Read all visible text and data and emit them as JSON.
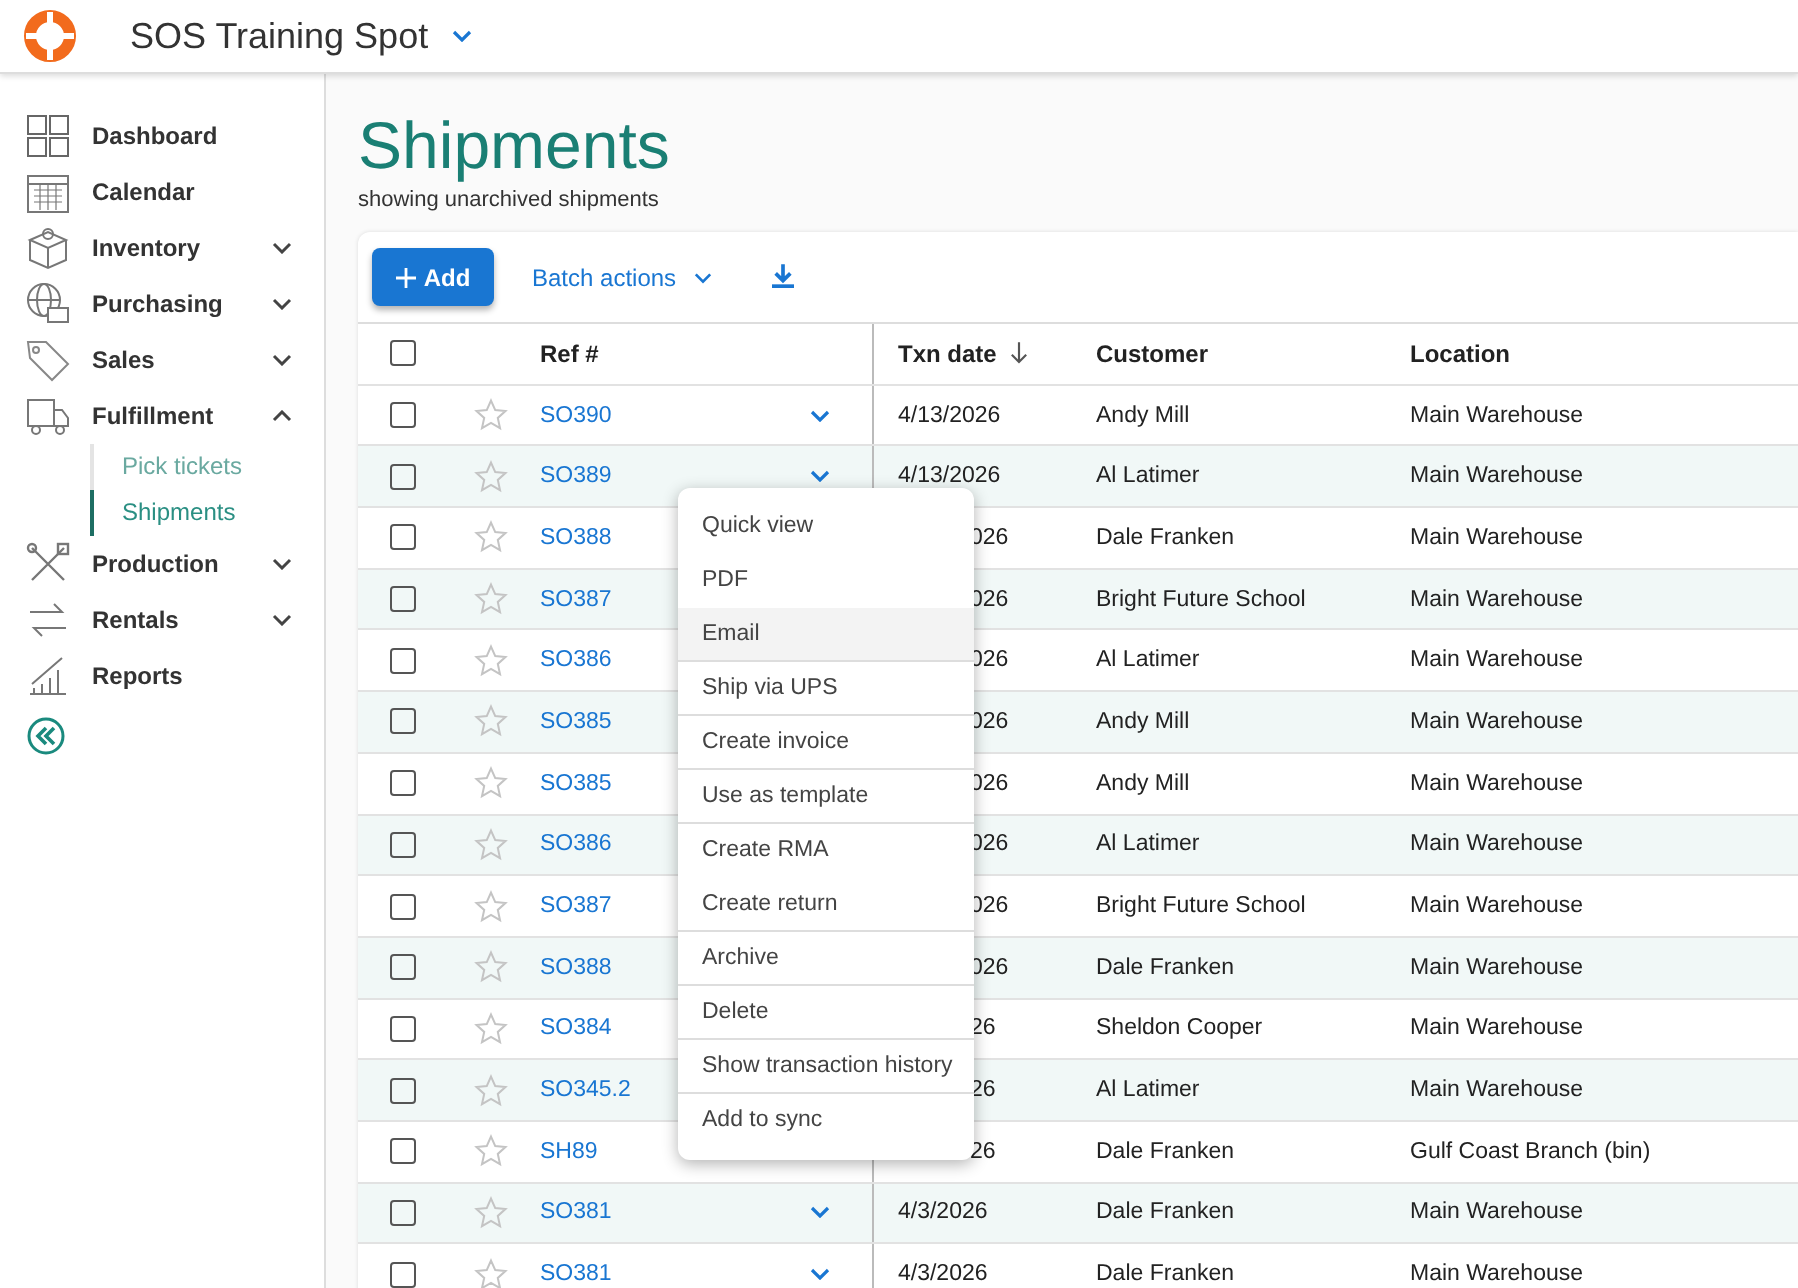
{
  "app": {
    "title": "SOS Training Spot"
  },
  "sidebar": {
    "items": [
      {
        "label": "Dashboard",
        "kind": "link"
      },
      {
        "label": "Calendar",
        "kind": "link"
      },
      {
        "label": "Inventory",
        "kind": "group",
        "expanded": false
      },
      {
        "label": "Purchasing",
        "kind": "group",
        "expanded": false
      },
      {
        "label": "Sales",
        "kind": "group",
        "expanded": false
      },
      {
        "label": "Fulfillment",
        "kind": "group",
        "expanded": true,
        "children": [
          {
            "label": "Pick tickets",
            "selected": false
          },
          {
            "label": "Shipments",
            "selected": true
          }
        ]
      },
      {
        "label": "Production",
        "kind": "group",
        "expanded": false
      },
      {
        "label": "Rentals",
        "kind": "group",
        "expanded": false
      },
      {
        "label": "Reports",
        "kind": "link"
      }
    ]
  },
  "page": {
    "title": "Shipments",
    "subtitle": "showing unarchived shipments"
  },
  "toolbar": {
    "add": "Add",
    "batch": "Batch actions"
  },
  "table": {
    "select_all": false,
    "columns": [
      {
        "label": "Ref #",
        "sorted": false
      },
      {
        "label": "Txn date",
        "sorted": true
      },
      {
        "label": "Customer",
        "sorted": false
      },
      {
        "label": "Location",
        "sorted": false
      }
    ],
    "rows": [
      {
        "ref": "SO390",
        "date": "4/13/2026",
        "date_cut": false,
        "customer": "Andy Mill",
        "location": "Main Warehouse",
        "checked": false,
        "starred": false,
        "caret": true
      },
      {
        "ref": "SO389",
        "date": "4/13/2026",
        "date_cut": false,
        "customer": "Al Latimer",
        "location": "Main Warehouse",
        "checked": false,
        "starred": false,
        "caret": true
      },
      {
        "ref": "SO388",
        "date": "026",
        "date_cut": true,
        "customer": "Dale Franken",
        "location": "Main Warehouse",
        "checked": false,
        "starred": false,
        "caret": false
      },
      {
        "ref": "SO387",
        "date": "026",
        "date_cut": true,
        "customer": "Bright Future School",
        "location": "Main Warehouse",
        "checked": false,
        "starred": false,
        "caret": false
      },
      {
        "ref": "SO386",
        "date": "026",
        "date_cut": true,
        "customer": "Al Latimer",
        "location": "Main Warehouse",
        "checked": false,
        "starred": false,
        "caret": false
      },
      {
        "ref": "SO385",
        "date": "026",
        "date_cut": true,
        "customer": "Andy Mill",
        "location": "Main Warehouse",
        "checked": false,
        "starred": false,
        "caret": false
      },
      {
        "ref": "SO385",
        "date": "026",
        "date_cut": true,
        "customer": "Andy Mill",
        "location": "Main Warehouse",
        "checked": false,
        "starred": false,
        "caret": false
      },
      {
        "ref": "SO386",
        "date": "026",
        "date_cut": true,
        "customer": "Al Latimer",
        "location": "Main Warehouse",
        "checked": false,
        "starred": false,
        "caret": false
      },
      {
        "ref": "SO387",
        "date": "026",
        "date_cut": true,
        "customer": "Bright Future School",
        "location": "Main Warehouse",
        "checked": false,
        "starred": false,
        "caret": false
      },
      {
        "ref": "SO388",
        "date": "026",
        "date_cut": true,
        "customer": "Dale Franken",
        "location": "Main Warehouse",
        "checked": false,
        "starred": false,
        "caret": false
      },
      {
        "ref": "SO384",
        "date": "26",
        "date_cut": true,
        "customer": "Sheldon Cooper",
        "location": "Main Warehouse",
        "checked": false,
        "starred": false,
        "caret": false
      },
      {
        "ref": "SO345.2",
        "date": "26",
        "date_cut": true,
        "customer": "Al Latimer",
        "location": "Main Warehouse",
        "checked": false,
        "starred": false,
        "caret": false
      },
      {
        "ref": "SH89",
        "date": "26",
        "date_cut": true,
        "customer": "Dale Franken",
        "location": "Gulf Coast Branch (bin)",
        "checked": false,
        "starred": false,
        "caret": false
      },
      {
        "ref": "SO381",
        "date": "4/3/2026",
        "date_cut": false,
        "customer": "Dale Franken",
        "location": "Main Warehouse",
        "checked": false,
        "starred": false,
        "caret": true
      },
      {
        "ref": "SO381",
        "date": "4/3/2026",
        "date_cut": false,
        "customer": "Dale Franken",
        "location": "Main Warehouse",
        "checked": false,
        "starred": false,
        "caret": true
      }
    ]
  },
  "context_menu": {
    "items": [
      {
        "label": "Quick view",
        "hovered": false,
        "divider_after": false
      },
      {
        "label": "PDF",
        "hovered": false,
        "divider_after": false
      },
      {
        "label": "Email",
        "hovered": true,
        "divider_after": true
      },
      {
        "label": "Ship via UPS",
        "hovered": false,
        "divider_after": true
      },
      {
        "label": "Create invoice",
        "hovered": false,
        "divider_after": true
      },
      {
        "label": "Use as template",
        "hovered": false,
        "divider_after": true
      },
      {
        "label": "Create RMA",
        "hovered": false,
        "divider_after": false
      },
      {
        "label": "Create return",
        "hovered": false,
        "divider_after": true
      },
      {
        "label": "Archive",
        "hovered": false,
        "divider_after": true
      },
      {
        "label": "Delete",
        "hovered": false,
        "divider_after": true
      },
      {
        "label": "Show transaction history",
        "hovered": false,
        "divider_after": true
      },
      {
        "label": "Add to sync",
        "hovered": false,
        "divider_after": false
      }
    ]
  }
}
